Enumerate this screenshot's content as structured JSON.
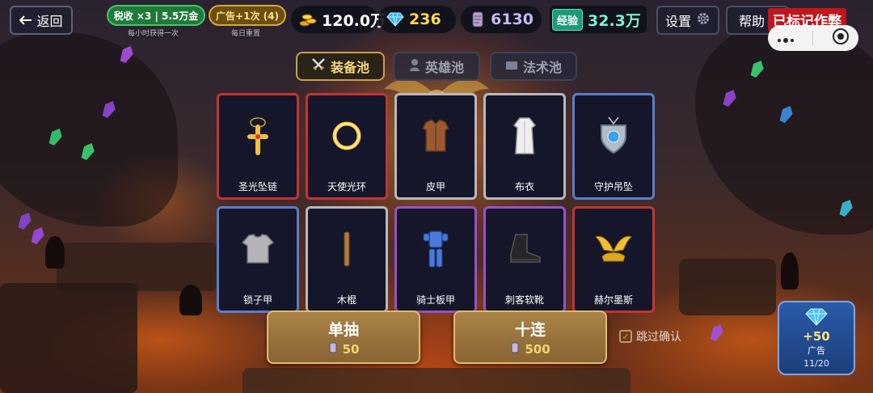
{
  "top": {
    "back_label": "返回",
    "tax_label": "税收 ×3 | 5.5万金",
    "tax_sub": "每小时获得一次",
    "ad_bonus_label": "广告+1次 (4)",
    "ad_bonus_sub": "每日重置",
    "gold": "120.0万",
    "gems": "236",
    "scroll": "6130",
    "exp_tag": "经验",
    "exp": "32.3万",
    "settings_label": "设置",
    "help_label": "帮助",
    "cheat_flag": "已标记作弊"
  },
  "tabs": [
    {
      "label": "装备池",
      "icon": "crossed-swords-icon",
      "active": true
    },
    {
      "label": "英雄池",
      "icon": "hero-icon",
      "active": false
    },
    {
      "label": "法术池",
      "icon": "spellbook-icon",
      "active": false
    }
  ],
  "cards": [
    {
      "name": "圣光坠链",
      "rarity": "red",
      "icon": "holy-pendant-icon"
    },
    {
      "name": "天使光环",
      "rarity": "red",
      "icon": "halo-icon"
    },
    {
      "name": "皮甲",
      "rarity": "white",
      "icon": "leather-armor-icon"
    },
    {
      "name": "布衣",
      "rarity": "white",
      "icon": "cloth-robe-icon"
    },
    {
      "name": "守护吊坠",
      "rarity": "blue",
      "icon": "guardian-amulet-icon"
    },
    {
      "name": "锁子甲",
      "rarity": "blue",
      "icon": "chainmail-icon"
    },
    {
      "name": "木棍",
      "rarity": "white",
      "icon": "wooden-stick-icon"
    },
    {
      "name": "骑士板甲",
      "rarity": "purple",
      "icon": "plate-armor-icon"
    },
    {
      "name": "刺客软靴",
      "rarity": "purple",
      "icon": "boots-icon"
    },
    {
      "name": "赫尔墨斯",
      "rarity": "red",
      "icon": "winged-sandal-icon"
    }
  ],
  "draw": {
    "single_label": "单抽",
    "single_cost": "50",
    "ten_label": "十连",
    "ten_cost": "500",
    "skip_label": "跳过确认"
  },
  "ad_reward": {
    "amount": "+50",
    "label": "广告",
    "count": "11/20"
  },
  "colors": {
    "red": "#c23434",
    "white": "#b8b8bc",
    "blue": "#5a7ec9",
    "purple": "#9552c9",
    "gold_accent": "#e0bd6e",
    "exp": "#7cf0cd"
  }
}
